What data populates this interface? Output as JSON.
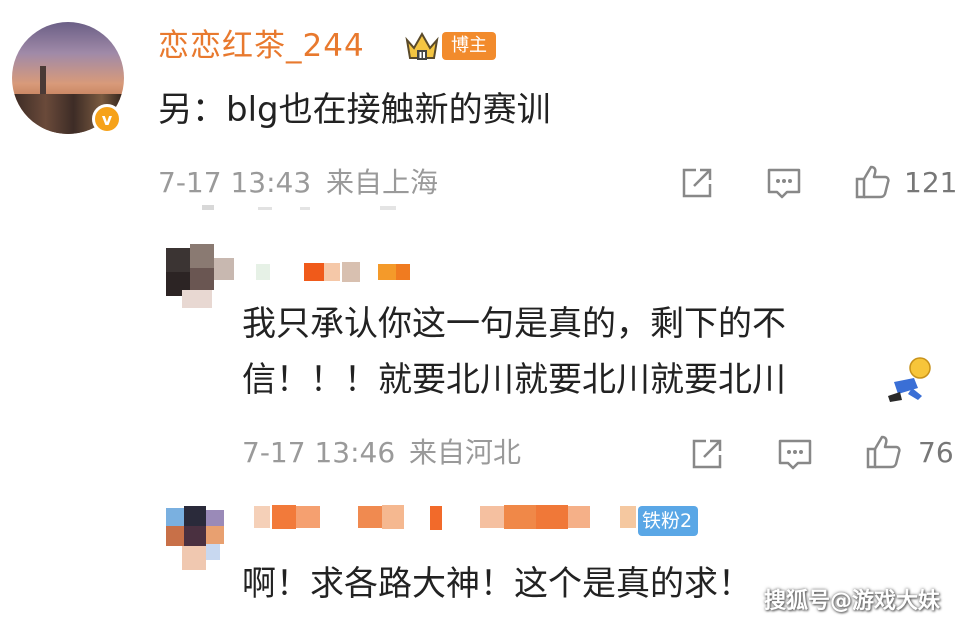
{
  "main_comment": {
    "username": "恋恋红茶_244",
    "badge": "博主",
    "verified_icon": "v-icon",
    "text": "另：blg也在接触新的赛训",
    "timestamp": "7-17 13:43",
    "location": "来自上海",
    "likes": "121"
  },
  "reply1": {
    "text_line1": "我只承认你这一句是真的，剩下的不",
    "text_line2": "信！！！就要北川就要北川就要北川",
    "emoji": "kneel-emoji",
    "timestamp": "7-17 13:46",
    "location": "来自河北",
    "likes": "76"
  },
  "reply2": {
    "fan_badge": "铁粉2",
    "text": "啊！求各路大神！这个是真的求！"
  },
  "watermark": "搜狐号@游戏大妹",
  "colors": {
    "username": "#e8792e",
    "badge": "#f28b2c",
    "fan_badge": "#5aa7e6"
  }
}
